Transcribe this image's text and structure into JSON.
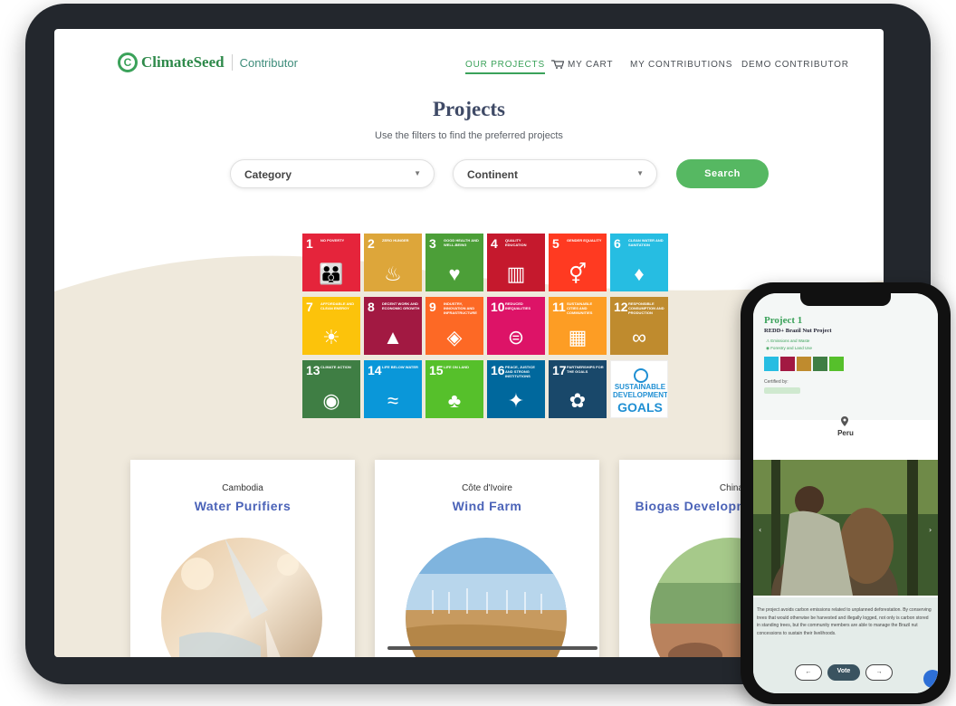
{
  "tablet": {
    "nav": {
      "logo_text": "ClimateSeed",
      "logo_sub": "Contributor",
      "items": [
        {
          "label": "OUR PROJECTS",
          "active": true
        },
        {
          "label": "MY CART",
          "active": false
        },
        {
          "label": "MY CONTRIBUTIONS",
          "active": false
        },
        {
          "label": "DEMO CONTRIBUTOR",
          "active": false
        }
      ]
    },
    "page_title": "Projects",
    "subtitle": "Use the filters to find the preferred projects",
    "filters": {
      "category_value": "Category",
      "continent_value": "Continent",
      "search_label": "Search"
    },
    "sdg_goals": [
      {
        "num": "1",
        "label": "No poverty",
        "color": "#e5243b",
        "icon": "family-icon"
      },
      {
        "num": "2",
        "label": "Zero hunger",
        "color": "#dda63a",
        "icon": "bowl-icon"
      },
      {
        "num": "3",
        "label": "Good health and well-being",
        "color": "#4c9f38",
        "icon": "heartbeat-icon"
      },
      {
        "num": "4",
        "label": "Quality education",
        "color": "#c5192d",
        "icon": "book-icon"
      },
      {
        "num": "5",
        "label": "Gender equality",
        "color": "#ff3a21",
        "icon": "gender-icon"
      },
      {
        "num": "6",
        "label": "Clean water and sanitation",
        "color": "#26bde2",
        "icon": "water-drop-icon"
      },
      {
        "num": "7",
        "label": "Affordable and clean energy",
        "color": "#fcc30b",
        "icon": "sun-icon"
      },
      {
        "num": "8",
        "label": "Decent work and economic growth",
        "color": "#a21942",
        "icon": "growth-chart-icon"
      },
      {
        "num": "9",
        "label": "Industry, innovation and infrastructure",
        "color": "#fd6925",
        "icon": "cubes-icon"
      },
      {
        "num": "10",
        "label": "Reduced inequalities",
        "color": "#dd1367",
        "icon": "equal-icon"
      },
      {
        "num": "11",
        "label": "Sustainable cities and communities",
        "color": "#fd9d24",
        "icon": "city-icon"
      },
      {
        "num": "12",
        "label": "Responsible consumption and production",
        "color": "#bf8b2e",
        "icon": "infinity-icon"
      },
      {
        "num": "13",
        "label": "Climate action",
        "color": "#3f7e44",
        "icon": "eye-globe-icon"
      },
      {
        "num": "14",
        "label": "Life below water",
        "color": "#0a97d9",
        "icon": "fish-icon"
      },
      {
        "num": "15",
        "label": "Life on land",
        "color": "#56c02b",
        "icon": "tree-icon"
      },
      {
        "num": "16",
        "label": "Peace, justice and strong institutions",
        "color": "#00689d",
        "icon": "dove-icon"
      },
      {
        "num": "17",
        "label": "Partnerships for the goals",
        "color": "#19486a",
        "icon": "rings-icon"
      }
    ],
    "sdg_logo": {
      "line1": "SUSTAINABLE",
      "line2": "DEVELOPMENT",
      "line3": "GOALS"
    },
    "cards": [
      {
        "country": "Cambodia",
        "title": "Water Purifiers",
        "image": "water-pouring"
      },
      {
        "country": "Côte d'Ivoire",
        "title": "Wind Farm",
        "image": "wind-turbines"
      },
      {
        "country": "China",
        "title": "Biogas Development Program",
        "image": "biogas-field"
      }
    ]
  },
  "phone": {
    "project_label": "Project 1",
    "project_name": "REDD+ Brazil Nut Project",
    "tags": [
      "Emissions and Waste",
      "Forestry and Land Use"
    ],
    "certified_label": "Certified by:",
    "location": "Peru",
    "description": "The project avoids carbon emissions related to unplanned deforestation. By conserving trees that would otherwise be harvested and illegally logged, not only is carbon stored in standing trees, but the community members are able to manage the Brazil nut concessions to sustain their livelihoods.",
    "vote_label": "Vote"
  },
  "colors": {
    "brand_green": "#3ba25a",
    "accent_blue": "#4b63b8",
    "title_navy": "#3f4a66"
  }
}
